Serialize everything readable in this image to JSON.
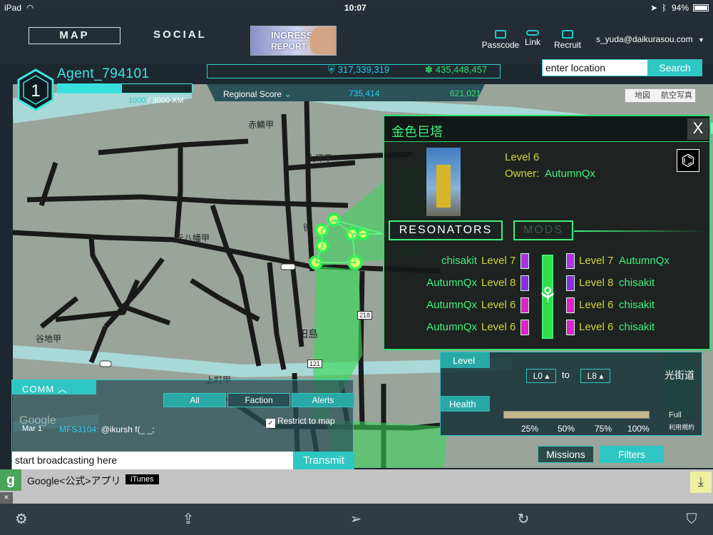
{
  "status": {
    "device": "iPad",
    "time": "10:07",
    "battery": "94%"
  },
  "nav": {
    "map": "MAP",
    "social": "SOCIAL",
    "banner_line1": "INGRESS",
    "banner_line2": "REPORT"
  },
  "account": {
    "passcode": "Passcode",
    "link": "Link",
    "recruit": "Recruit",
    "email": "s_yuda@daikurasou.com"
  },
  "agent": {
    "level": "1",
    "name": "Agent_794101",
    "xp_current": "1000",
    "xp_total": "/ 3000 XM",
    "xp_fraction": 0.48
  },
  "global_score": {
    "resistance": "317,339,319",
    "enlightened": "435,448,457"
  },
  "regional": {
    "label": "Regional Score",
    "resistance": "735,414",
    "enlightened": "621,021"
  },
  "search": {
    "value": "enter location",
    "button": "Search"
  },
  "maptoggle": {
    "map": "地図",
    "satellite": "航空写真"
  },
  "map_labels": [
    "赤鱗甲",
    "大坪甲",
    "元八幡甲",
    "谷地甲",
    "田島",
    "上町甲",
    "後"
  ],
  "map_road_numbers": [
    "218",
    "121"
  ],
  "portal": {
    "name": "金色巨塔",
    "close": "X",
    "level": "Level 6",
    "owner_label": "Owner:",
    "owner": "AutumnQx",
    "tab_resonators": "RESONATORS",
    "tab_mods": "MODS",
    "left": [
      {
        "owner": "chisakit",
        "level": "Level 7"
      },
      {
        "owner": "AutumnQx",
        "level": "Level 8"
      },
      {
        "owner": "AutumnQx",
        "level": "Level 6"
      },
      {
        "owner": "AutumnQx",
        "level": "Level 6"
      }
    ],
    "right": [
      {
        "level": "Level 7",
        "owner": "AutumnQx"
      },
      {
        "level": "Level 8",
        "owner": "chisakit"
      },
      {
        "level": "Level 6",
        "owner": "chisakit"
      },
      {
        "level": "Level 6",
        "owner": "chisakit"
      }
    ],
    "colors": {
      "level6": "#e020c8",
      "level7": "#b030e8",
      "level8": "#8a2cdf"
    }
  },
  "filters": {
    "level_label": "Level",
    "from": "L0",
    "to_word": "to",
    "to": "L8",
    "health_label": "Health",
    "ticks": [
      "25%",
      "50%",
      "75%",
      "100%"
    ]
  },
  "corner": {
    "street": "光街道",
    "full": "Full",
    "terms": "利用規約"
  },
  "buttons": {
    "missions": "Missions",
    "filters": "Filters"
  },
  "comm": {
    "title": "COMM",
    "tabs": [
      "All",
      "Faction",
      "Alerts"
    ],
    "restrict": "Restrict to map",
    "date": "Mar 1",
    "sender": "MFS3104:",
    "message": "@ikursh f(_ _;",
    "watermark": "Google",
    "input_placeholder": "start broadcasting here",
    "send": "Transmit"
  },
  "ad": {
    "icon": "g",
    "text": "Google<公式>アプリ",
    "badge": "iTunes",
    "close": "×"
  },
  "toolbar": [
    "settings-icon",
    "share-icon",
    "location-arrow-icon",
    "refresh-icon",
    "faction-icon"
  ]
}
